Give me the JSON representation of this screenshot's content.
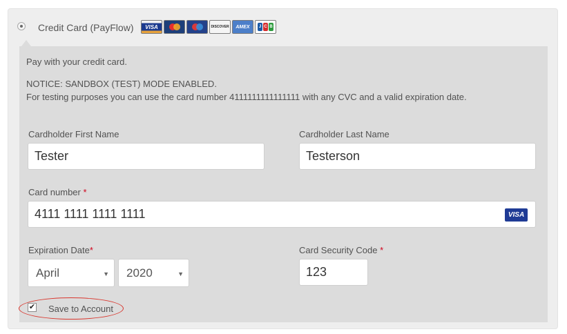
{
  "payment_method": {
    "title": "Credit Card (PayFlow)",
    "card_logos": [
      "VISA",
      "MasterCard",
      "Maestro",
      "DISCOVER",
      "AMEX",
      "JCB"
    ]
  },
  "panel": {
    "intro": "Pay with your credit card.",
    "notice": "NOTICE: SANDBOX (TEST) MODE ENABLED.",
    "notice_detail": "For testing purposes you can use the card number 4111111111111111 with any CVC and a valid expiration date."
  },
  "form": {
    "first_name_label": "Cardholder First Name",
    "first_name_value": "Tester",
    "last_name_label": "Cardholder Last Name",
    "last_name_value": "Testerson",
    "card_number_label": "Card number",
    "card_number_value": "4111 1111 1111 1111",
    "card_brand_badge": "VISA",
    "expiration_label": "Expiration Date",
    "expiration_month": "April",
    "expiration_year": "2020",
    "cvc_label": "Card Security Code",
    "cvc_value": "123",
    "required_marker": "*",
    "save_label": "Save to Account",
    "save_checked": true
  },
  "colors": {
    "required": "#d0021b",
    "highlight_oval": "#d9342b",
    "panel_bg": "#dcdcdc",
    "outer_bg": "#eeeeee"
  }
}
